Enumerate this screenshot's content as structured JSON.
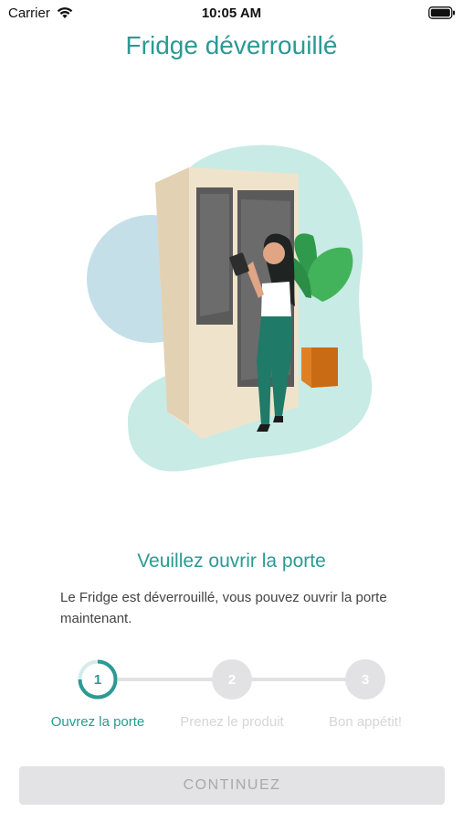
{
  "status_bar": {
    "carrier": "Carrier",
    "time": "10:05 AM"
  },
  "page": {
    "title": "Fridge déverrouillé"
  },
  "content": {
    "subtitle": "Veuillez ouvrir la porte",
    "description": "Le Fridge est déverrouillé, vous pouvez ouvrir la porte maintenant."
  },
  "steps": [
    {
      "number": "1",
      "label": "Ouvrez la porte",
      "state": "active"
    },
    {
      "number": "2",
      "label": "Prenez le produit",
      "state": "inactive"
    },
    {
      "number": "3",
      "label": "Bon appétit!",
      "state": "inactive"
    }
  ],
  "actions": {
    "continue_label": "CONTINUEZ",
    "continue_enabled": false
  },
  "colors": {
    "accent": "#2a9a94",
    "inactive": "#e2e2e4"
  }
}
